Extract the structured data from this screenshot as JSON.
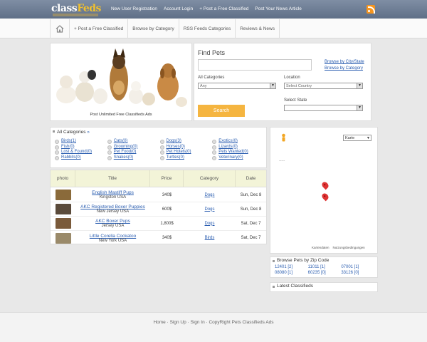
{
  "header": {
    "logo_a": "class",
    "logo_b": "Feds",
    "nav": [
      "New User Registration",
      "Account Login",
      "+ Post a Free Classified",
      "Post Your News Article"
    ]
  },
  "subnav": [
    "+ Post a Free Classified",
    "Browse by Category",
    "RSS Feeds Categories",
    "Reviews & News"
  ],
  "hero": {
    "caption": "Post Unlimited Free Classifieds Ads"
  },
  "find": {
    "title": "Find Pets",
    "link_city": "Browse by City/State",
    "link_category": "Browse by Category",
    "categories_label": "All Categories",
    "category_value": "Any",
    "location_label": "Location",
    "country_value": "Select Country",
    "state_label": "Select State",
    "state_value": "",
    "search_label": "Search"
  },
  "categories": {
    "title": "All Categories",
    "arrow": "»",
    "items": [
      "Birds(1)",
      "Cats(0)",
      "Dogs(3)",
      "Exotics(0)",
      "Fish(0)",
      "Grooming(0)",
      "Horses(0)",
      "Lizards(0)",
      "Lost & Found(0)",
      "Pet Food(0)",
      "Pet Hotels(0)",
      "Pets Wanted(0)",
      "Rabbits(0)",
      "Snakes(0)",
      "Turtles(0)",
      "Veterinary(0)"
    ]
  },
  "listings": {
    "columns": [
      "photo",
      "Title",
      "Price",
      "Category",
      "Date"
    ],
    "rows": [
      {
        "title": "English Mastiff Pups",
        "location": "Kingston USA",
        "price": "340$",
        "category": "Dogs",
        "date": "Sun, Dec 8"
      },
      {
        "title": "AKC Registered Boxer Puppies",
        "location": "New Jersey USA",
        "price": "600$",
        "category": "Dogs",
        "date": "Sun, Dec 8"
      },
      {
        "title": "AKC Boxer Pups",
        "location": "Jersey USA",
        "price": "1,800$",
        "category": "Dogs",
        "date": "Sat, Dec 7"
      },
      {
        "title": "Little Corella Cockatoo",
        "location": "New York USA",
        "price": "340$",
        "category": "Birds",
        "date": "Sat, Dec 7"
      }
    ]
  },
  "map": {
    "type_value": "Karte",
    "dots": "-----",
    "data_label": "Kartendaten",
    "terms_label": "Nutzungsbedingungen"
  },
  "zip": {
    "title": "Browse Pets by Zip Code",
    "codes": [
      "12401 [2]",
      "11011 [1]",
      "07001 [1]",
      "08080 [1]",
      "60235 [0]",
      "33126 [0]"
    ]
  },
  "latest": {
    "title": "Latest Classifieds"
  },
  "footer": {
    "links": "Home · Sign Up · Sign In · CopyRight Pets Classifieds Ads"
  },
  "colors": {
    "header": "#6e7e96",
    "accent": "#f5b540",
    "link": "#2a5db0",
    "pin": "#dd3333"
  }
}
